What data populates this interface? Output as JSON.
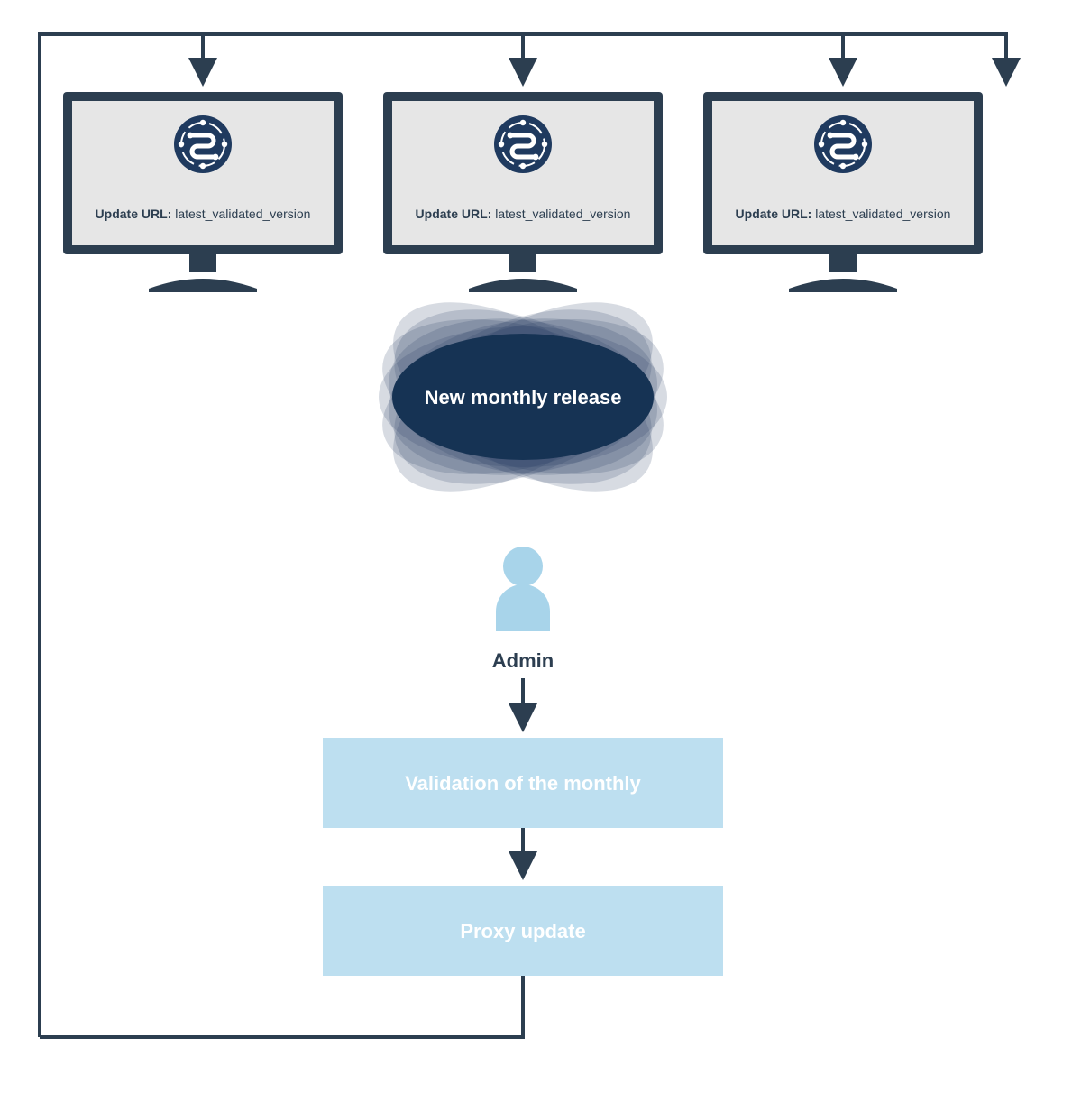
{
  "monitors": [
    {
      "label_prefix": "Update URL: ",
      "label_value": "latest_validated_version"
    },
    {
      "label_prefix": "Update URL: ",
      "label_value": "latest_validated_version"
    },
    {
      "label_prefix": "Update URL: ",
      "label_value": "latest_validated_version"
    }
  ],
  "cloud_label": "New monthly release",
  "admin_label": "Admin",
  "box1_label": "Validation of the monthly",
  "box2_label": "Proxy update",
  "colors": {
    "dark": "#2c3e50",
    "navy": "#1f3a5f",
    "navy2": "#1b3a66",
    "light": "#a8d4ea",
    "lighter": "#bddff0",
    "screen": "#e6e6e6"
  }
}
